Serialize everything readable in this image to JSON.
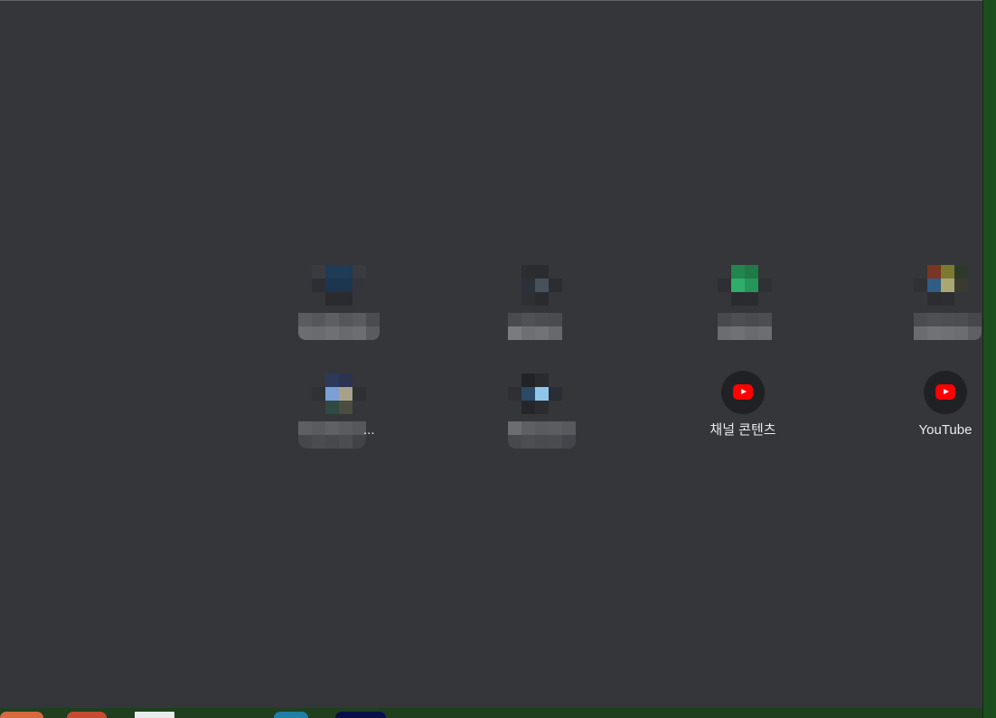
{
  "new_tab": {
    "shortcuts": [
      {
        "title": "",
        "icon": "blurred-favicon-1"
      },
      {
        "title": "",
        "icon": "blurred-favicon-2"
      },
      {
        "title": "",
        "icon": "blurred-favicon-3"
      },
      {
        "title": "",
        "icon": "blurred-favicon-4"
      },
      {
        "title": "...",
        "icon": "blurred-favicon-5"
      },
      {
        "title": "",
        "icon": "blurred-favicon-6"
      },
      {
        "title": "채널 콘텐츠",
        "icon": "youtube-icon"
      },
      {
        "title": "YouTube",
        "icon": "youtube-icon"
      }
    ]
  },
  "colors": {
    "page_background": "#35363a",
    "tile_circle": "#202124",
    "text": "#e8eaed",
    "youtube_red": "#ff0000",
    "desktop_green": "#1b4a1b"
  }
}
